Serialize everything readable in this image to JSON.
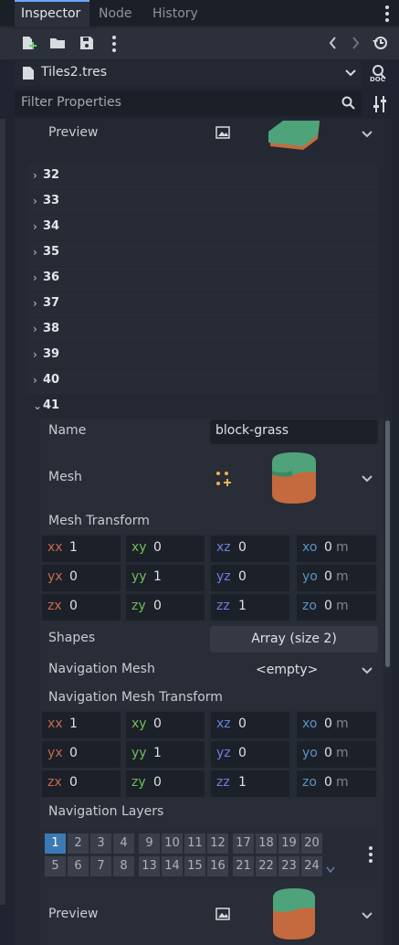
{
  "tabs": [
    {
      "label": "Inspector",
      "active": true
    },
    {
      "label": "Node",
      "active": false
    },
    {
      "label": "History",
      "active": false
    }
  ],
  "toolbar": {
    "icons": [
      "new-resource-icon",
      "open-folder-icon",
      "save-icon",
      "more-icon",
      "back-icon",
      "forward-icon",
      "history-icon"
    ]
  },
  "resource": {
    "name": "Tiles2.tres",
    "doc_label": "DOC"
  },
  "filter": {
    "placeholder": "Filter Properties"
  },
  "top_preview": {
    "label": "Preview"
  },
  "collapsed_items": [
    "32",
    "33",
    "34",
    "35",
    "36",
    "37",
    "38",
    "39",
    "40"
  ],
  "expanded_item": {
    "index": "41",
    "name_label": "Name",
    "name_value": "block-grass",
    "mesh_label": "Mesh",
    "mesh_transform_label": "Mesh Transform",
    "mesh_transform": [
      [
        {
          "k": "xx",
          "v": "1"
        },
        {
          "k": "xy",
          "v": "0"
        },
        {
          "k": "xz",
          "v": "0"
        },
        {
          "k": "xo",
          "v": "0",
          "u": "m"
        }
      ],
      [
        {
          "k": "yx",
          "v": "0"
        },
        {
          "k": "yy",
          "v": "1"
        },
        {
          "k": "yz",
          "v": "0"
        },
        {
          "k": "yo",
          "v": "0",
          "u": "m"
        }
      ],
      [
        {
          "k": "zx",
          "v": "0"
        },
        {
          "k": "zy",
          "v": "0"
        },
        {
          "k": "zz",
          "v": "1"
        },
        {
          "k": "zo",
          "v": "0",
          "u": "m"
        }
      ]
    ],
    "shapes_label": "Shapes",
    "shapes_value": "Array (size 2)",
    "nav_mesh_label": "Navigation Mesh",
    "nav_mesh_value": "<empty>",
    "nav_transform_label": "Navigation Mesh Transform",
    "nav_transform": [
      [
        {
          "k": "xx",
          "v": "1"
        },
        {
          "k": "xy",
          "v": "0"
        },
        {
          "k": "xz",
          "v": "0"
        },
        {
          "k": "xo",
          "v": "0",
          "u": "m"
        }
      ],
      [
        {
          "k": "yx",
          "v": "0"
        },
        {
          "k": "yy",
          "v": "1"
        },
        {
          "k": "yz",
          "v": "0"
        },
        {
          "k": "yo",
          "v": "0",
          "u": "m"
        }
      ],
      [
        {
          "k": "zx",
          "v": "0"
        },
        {
          "k": "zy",
          "v": "0"
        },
        {
          "k": "zz",
          "v": "1"
        },
        {
          "k": "zo",
          "v": "0",
          "u": "m"
        }
      ]
    ],
    "nav_layers_label": "Navigation Layers",
    "nav_layers_top": [
      "1",
      "2",
      "3",
      "4",
      "9",
      "10",
      "11",
      "12",
      "17",
      "18",
      "19",
      "20"
    ],
    "nav_layers_bottom": [
      "5",
      "6",
      "7",
      "8",
      "13",
      "14",
      "15",
      "16",
      "21",
      "22",
      "23",
      "24"
    ],
    "active_layer": "1",
    "preview_label": "Preview"
  },
  "colors": {
    "accent": "#6aa9ff",
    "active_layer": "#3c7ab5",
    "grass": "#4fa37a",
    "dirt": "#c46a3e"
  }
}
